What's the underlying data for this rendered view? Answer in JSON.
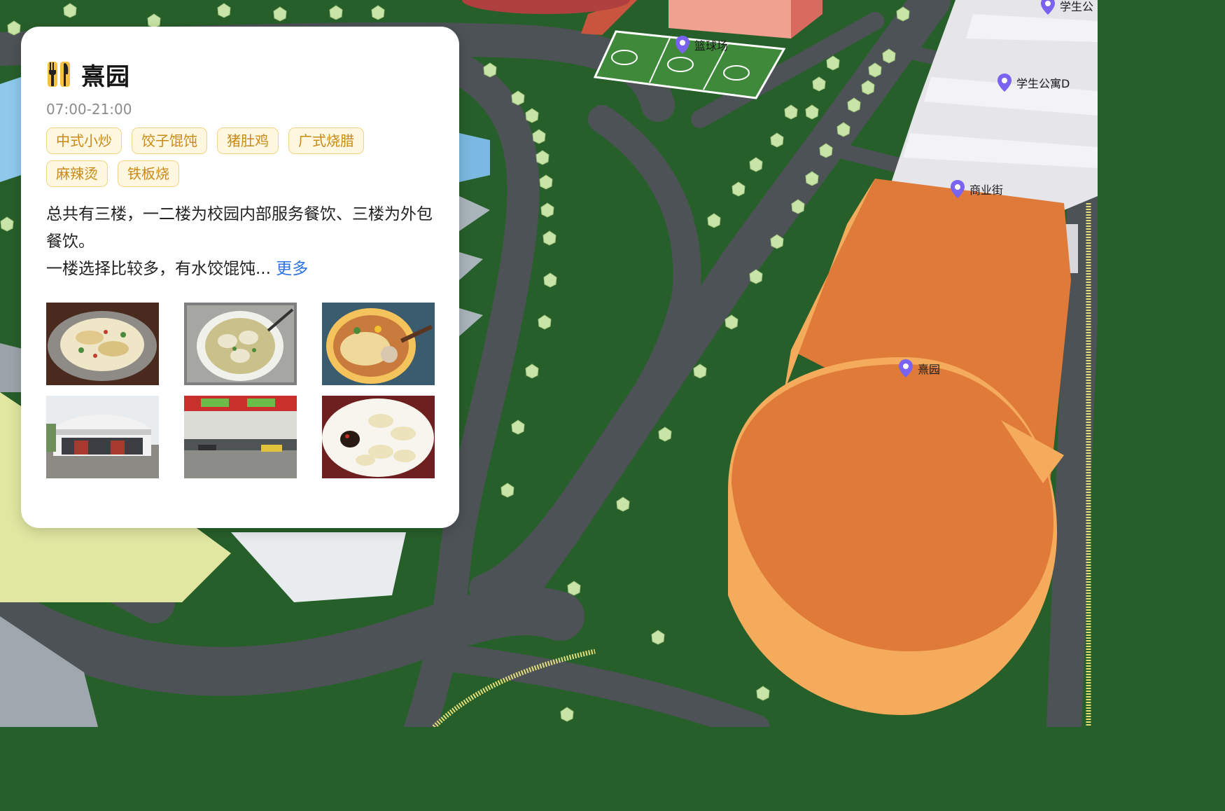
{
  "map": {
    "pois": [
      {
        "name": "学生公",
        "id": "poi-dorm-top"
      },
      {
        "name": "篮球场",
        "id": "poi-basketball"
      },
      {
        "name": "学生公寓D",
        "id": "poi-dorm-d"
      },
      {
        "name": "商业街",
        "id": "poi-commercial-street"
      },
      {
        "name": "熹园",
        "id": "poi-xiyuan"
      }
    ],
    "colors": {
      "grass": "#275f2a",
      "road": "#4d5256",
      "canteen_roof": "#e07a38",
      "canteen_wall": "#f4ab5c",
      "pin": "#7a63f0"
    }
  },
  "card": {
    "icon": "fork-knife-icon",
    "title": "熹园",
    "hours": "07:00-21:00",
    "tags": [
      "中式小炒",
      "饺子馄饨",
      "猪肚鸡",
      "广式烧腊",
      "麻辣烫",
      "铁板烧"
    ],
    "desc_line1": "总共有三楼，一二楼为校园内部服务餐饮、三楼为外包餐饮。",
    "desc_line2": "一楼选择比较多，有水饺馄饨...",
    "more_label": "更多",
    "photos": [
      {
        "subject": "fried-rice-noodle-rolls"
      },
      {
        "subject": "wonton-soup"
      },
      {
        "subject": "noodle-soup"
      },
      {
        "subject": "canteen-exterior"
      },
      {
        "subject": "canteen-interior"
      },
      {
        "subject": "dumplings-with-sauce"
      }
    ]
  }
}
